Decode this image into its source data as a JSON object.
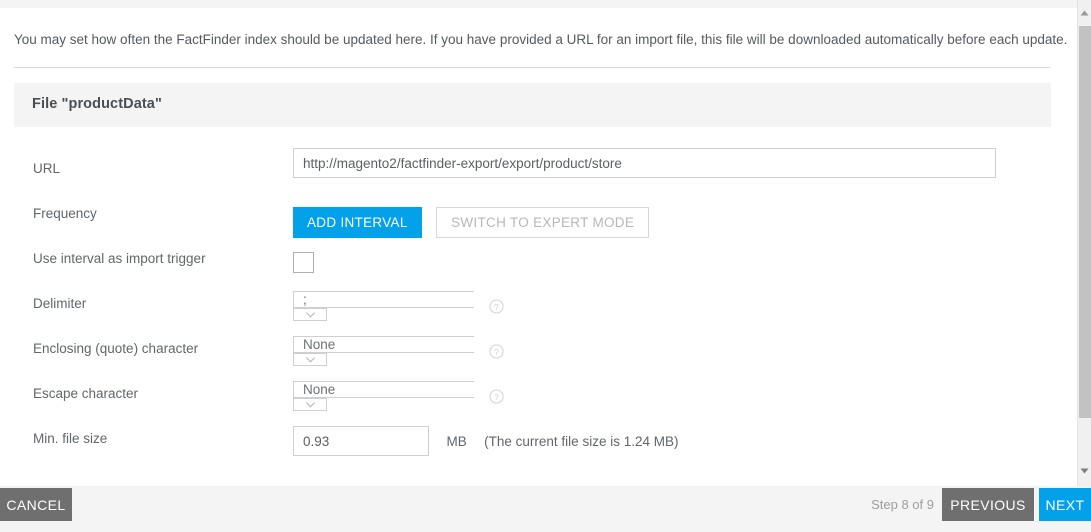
{
  "intro": {
    "text": "You may set how often the FactFinder index should be updated here. If you have provided a URL for an import file, this file will be downloaded automatically before each update."
  },
  "file_section": {
    "title": "File \"productData\""
  },
  "form": {
    "url": {
      "label": "URL",
      "value": "http://magento2/factfinder-export/export/product/store"
    },
    "frequency": {
      "label": "Frequency",
      "add_interval_label": "ADD INTERVAL",
      "expert_mode_label": "SWITCH TO EXPERT MODE"
    },
    "import_trigger": {
      "label": "Use interval as import trigger",
      "checked": false
    },
    "delimiter": {
      "label": "Delimiter",
      "value": ";"
    },
    "enclosing": {
      "label": "Enclosing (quote) character",
      "value": "None"
    },
    "escape": {
      "label": "Escape character",
      "value": "None"
    },
    "min_file_size": {
      "label": "Min. file size",
      "value": "0.93",
      "unit": "MB",
      "hint": "(The current file size is 1.24 MB)"
    }
  },
  "footer": {
    "cancel_label": "CANCEL",
    "step_text": "Step 8 of 9",
    "previous_label": "PREVIOUS",
    "next_label": "NEXT"
  },
  "colors": {
    "accent_blue": "#03a1ea",
    "button_grey": "#6f6f6f",
    "panel_grey": "#f4f4f4"
  }
}
